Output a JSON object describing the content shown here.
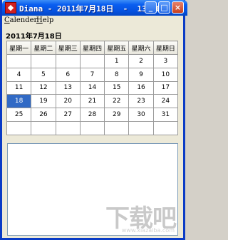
{
  "window": {
    "title": "Diana - 2011年7月18日  -  13:20",
    "app_icon": "diana-app-icon",
    "buttons": {
      "minimize": "_",
      "maximize": "□",
      "close": "×"
    }
  },
  "menu": {
    "items": [
      {
        "mnemonic": "C",
        "rest": "alender"
      },
      {
        "mnemonic": "H",
        "rest": "elp"
      }
    ]
  },
  "calendar": {
    "current_date_label": "2011年7月18日",
    "weekdays": [
      "星期一",
      "星期二",
      "星期三",
      "星期四",
      "星期五",
      "星期六",
      "星期日"
    ],
    "weeks": [
      [
        "",
        "",
        "",
        "",
        "1",
        "2",
        "3"
      ],
      [
        "4",
        "5",
        "6",
        "7",
        "8",
        "9",
        "10"
      ],
      [
        "11",
        "12",
        "13",
        "14",
        "15",
        "16",
        "17"
      ],
      [
        "18",
        "19",
        "20",
        "21",
        "22",
        "23",
        "24"
      ],
      [
        "25",
        "26",
        "27",
        "28",
        "29",
        "30",
        "31"
      ],
      [
        "",
        "",
        "",
        "",
        "",
        "",
        ""
      ]
    ],
    "selected_day": "18"
  },
  "notes": {
    "value": ""
  },
  "watermark": {
    "text": "下载吧",
    "sub": "www.xiazaiba.com"
  },
  "colors": {
    "titlebar": "#0552e0",
    "selected_cell": "#316ac5",
    "window_bg": "#ece9d8"
  }
}
